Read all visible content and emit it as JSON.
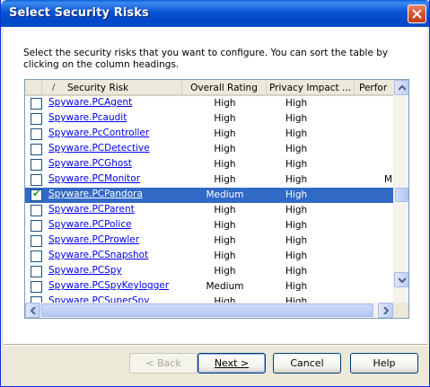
{
  "window": {
    "title": "Select Security Risks"
  },
  "instructions": "Select the security risks that you want to configure. You can sort the table by clicking on the column headings.",
  "table": {
    "columns": [
      "",
      "Security Risk",
      "Overall Rating",
      "Privacy Impact ...",
      "Perfor"
    ],
    "sort_indicator": "/",
    "rows": [
      {
        "checked": false,
        "name": "Spyware.PCAgent",
        "rating": "High",
        "privacy": "High",
        "perf": ""
      },
      {
        "checked": false,
        "name": "Spyware.Pcaudit",
        "rating": "High",
        "privacy": "High",
        "perf": ""
      },
      {
        "checked": false,
        "name": "Spyware.PcController",
        "rating": "High",
        "privacy": "High",
        "perf": ""
      },
      {
        "checked": false,
        "name": "Spyware.PCDetective",
        "rating": "High",
        "privacy": "High",
        "perf": ""
      },
      {
        "checked": false,
        "name": "Spyware.PCGhost",
        "rating": "High",
        "privacy": "High",
        "perf": ""
      },
      {
        "checked": false,
        "name": "Spyware.PCMonitor",
        "rating": "High",
        "privacy": "High",
        "perf": "M"
      },
      {
        "checked": true,
        "name": "Spyware.PCPandora",
        "rating": "Medium",
        "privacy": "High",
        "perf": "",
        "selected": true
      },
      {
        "checked": false,
        "name": "Spyware.PCParent",
        "rating": "High",
        "privacy": "High",
        "perf": ""
      },
      {
        "checked": false,
        "name": "Spyware.PCPolice",
        "rating": "High",
        "privacy": "High",
        "perf": ""
      },
      {
        "checked": false,
        "name": "Spyware.PCProwler",
        "rating": "High",
        "privacy": "High",
        "perf": ""
      },
      {
        "checked": false,
        "name": "Spyware.PCSnapshot",
        "rating": "High",
        "privacy": "High",
        "perf": ""
      },
      {
        "checked": false,
        "name": "Spyware.PCSpy",
        "rating": "High",
        "privacy": "High",
        "perf": ""
      },
      {
        "checked": false,
        "name": "Spyware.PCSpyKeylogger",
        "rating": "Medium",
        "privacy": "High",
        "perf": ""
      },
      {
        "checked": false,
        "name": "Spyware.PCSuperSpy",
        "rating": "High",
        "privacy": "High",
        "perf": ""
      }
    ]
  },
  "buttons": {
    "back": "< Back",
    "next": "Next >",
    "cancel": "Cancel",
    "help": "Help"
  },
  "colors": {
    "titlebar": "#0a54d0",
    "selection": "#316ac5",
    "link": "#0000ee",
    "face": "#ece9d8"
  },
  "icons": [
    "close-icon",
    "scroll-up-icon",
    "scroll-down-icon",
    "scroll-left-icon",
    "scroll-right-icon",
    "checkmark-icon"
  ]
}
